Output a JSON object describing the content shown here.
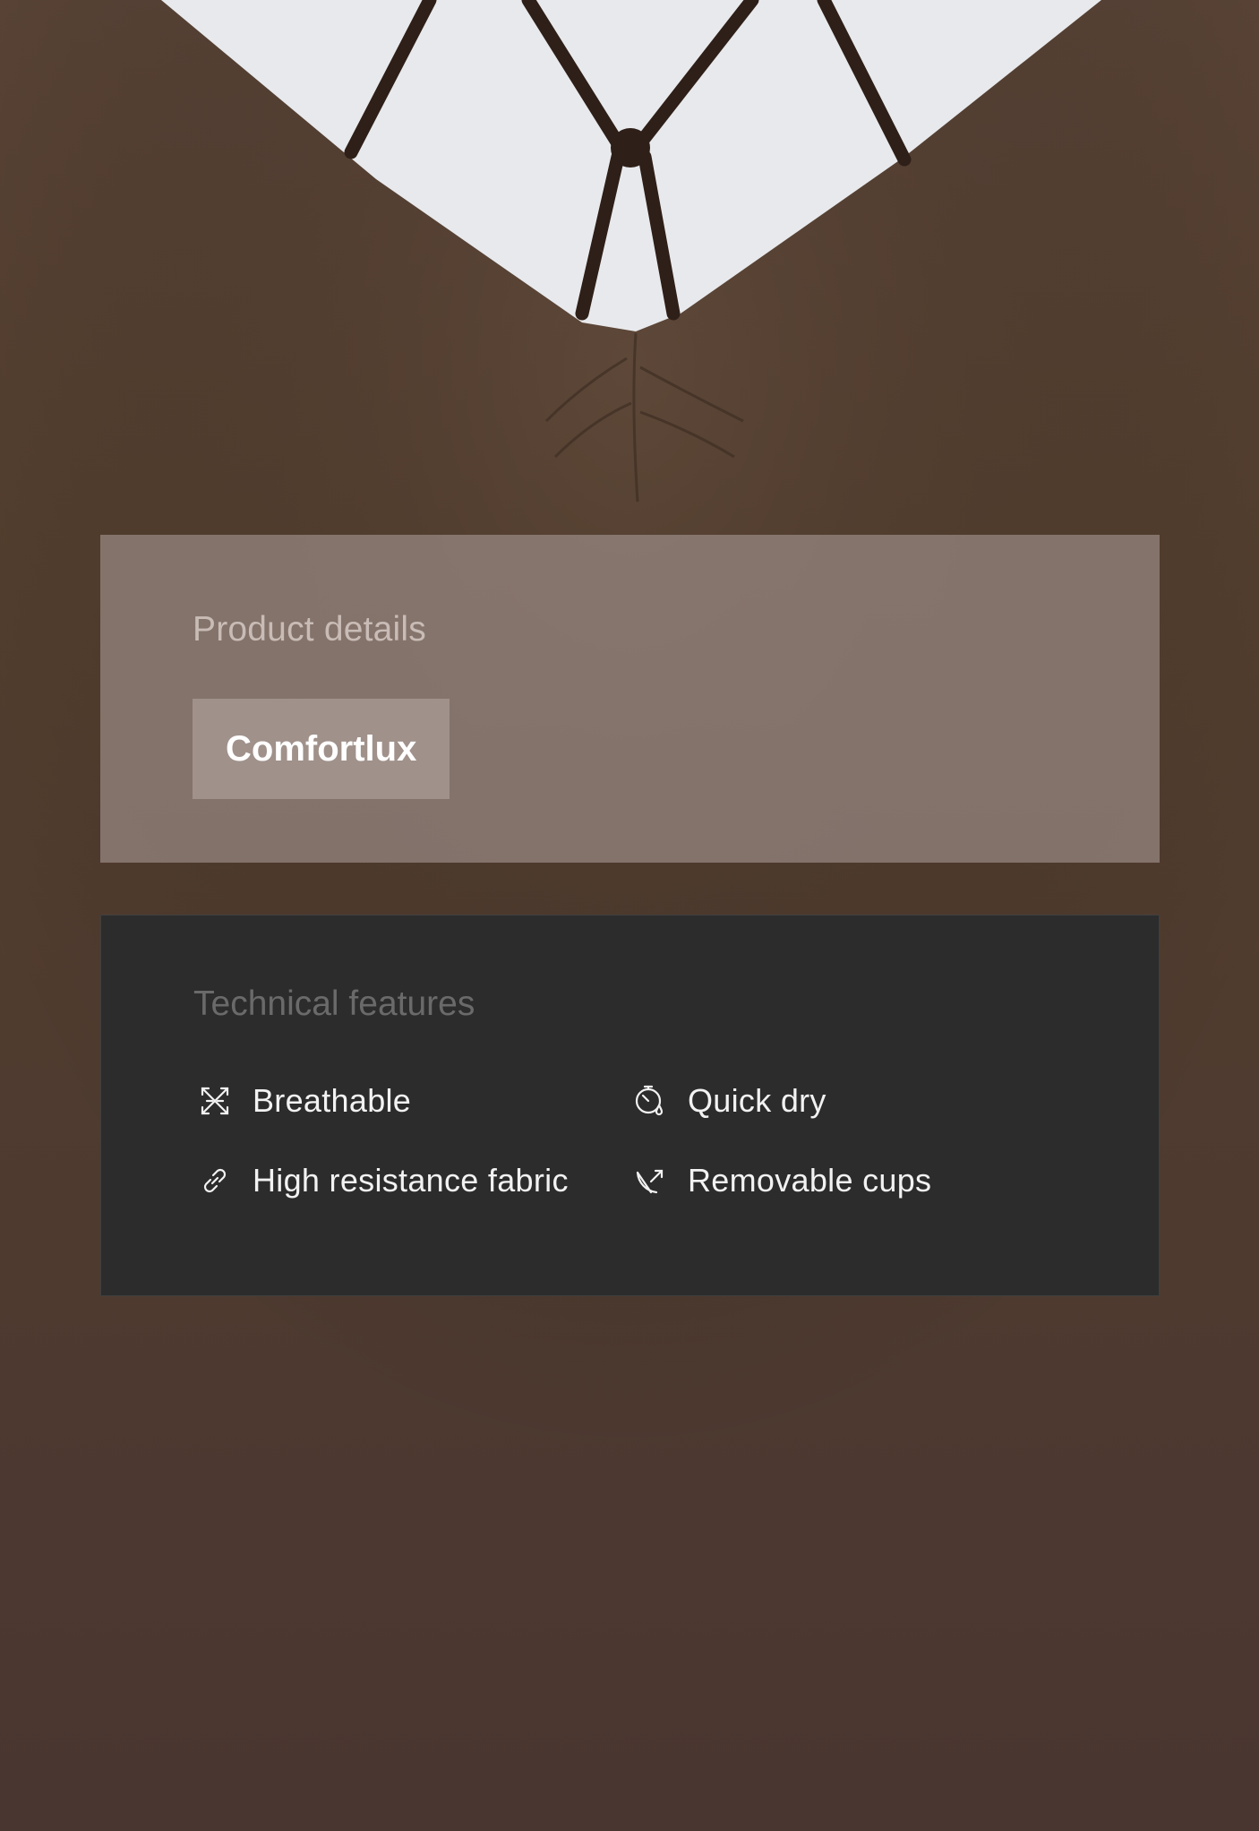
{
  "product_details": {
    "title": "Product details",
    "brand": "Comfortlux"
  },
  "technical_features": {
    "title": "Technical features",
    "items": [
      {
        "label": "Breathable",
        "icon": "breathable-icon"
      },
      {
        "label": "Quick dry",
        "icon": "quick-dry-icon"
      },
      {
        "label": "High resistance fabric",
        "icon": "link-icon"
      },
      {
        "label": "Removable cups",
        "icon": "removable-cups-icon"
      }
    ]
  },
  "colors": {
    "garment_brown": "#4d3a30",
    "details_overlay": "#a5968f",
    "features_panel": "#2c2c2c"
  }
}
